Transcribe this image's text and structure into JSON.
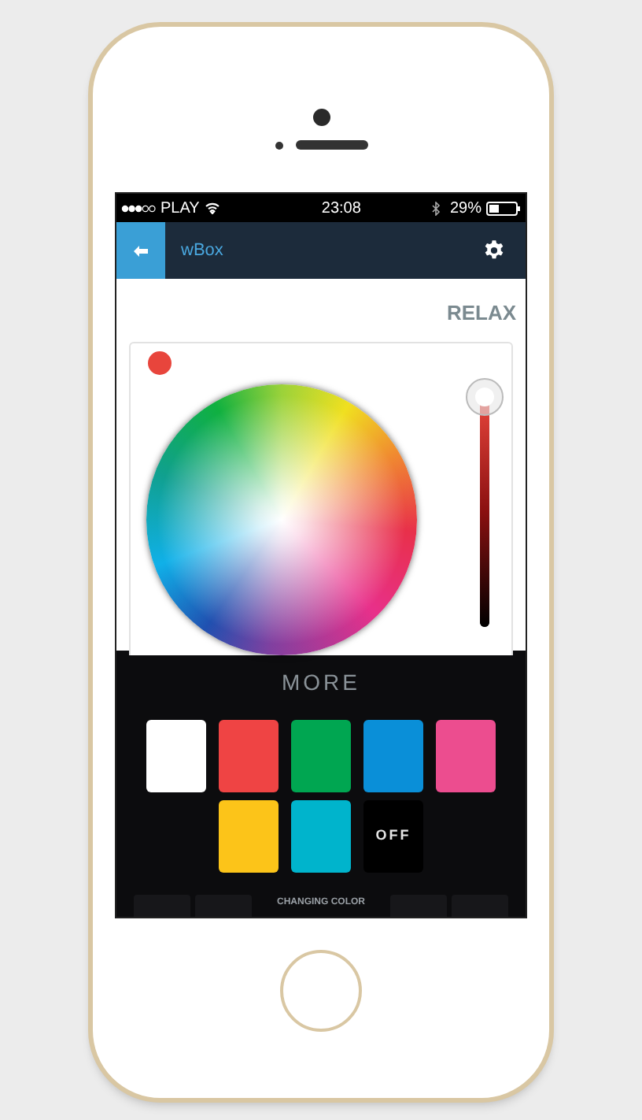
{
  "status_bar": {
    "carrier": "PLAY",
    "time": "23:08",
    "battery": "29%"
  },
  "nav_bar": {
    "title": "wBox"
  },
  "mode": "RELAX",
  "picker": {
    "brightness": {
      "level": 0.97
    }
  },
  "more": {
    "title": "MORE",
    "swatches": [
      {
        "kind": "color",
        "color": "#ffffff"
      },
      {
        "kind": "color",
        "color": "#ef4444"
      },
      {
        "kind": "color",
        "color": "#00a651"
      },
      {
        "kind": "color",
        "color": "#0a8fd8"
      },
      {
        "kind": "color",
        "color": "#ec4d8f"
      },
      {
        "kind": "color",
        "color": "#fcc419"
      },
      {
        "kind": "color",
        "color": "#00b4cc"
      },
      {
        "kind": "off",
        "label": "OFF"
      }
    ]
  },
  "bottom_bar": {
    "label": "CHANGING COLOR"
  }
}
